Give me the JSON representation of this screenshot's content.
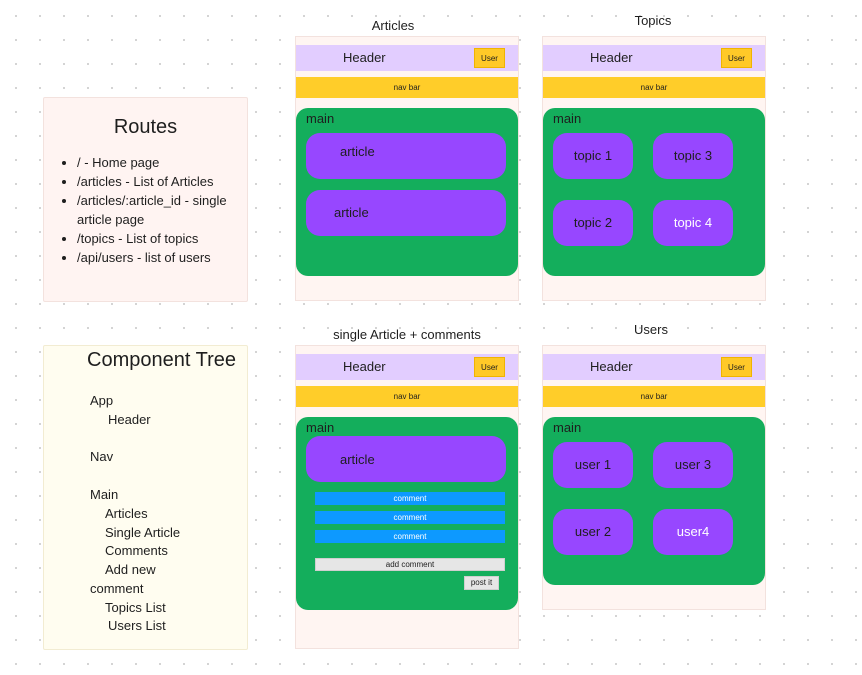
{
  "routes": {
    "title": "Routes",
    "items": [
      "/ - Home page",
      "/articles - List of Articles",
      "/articles/:article_id - single article page",
      "/topics - List of topics",
      "/api/users - list of users"
    ]
  },
  "component_tree": {
    "title": "Component Tree",
    "items": [
      "App",
      "Header",
      "Nav",
      "Main",
      "Articles",
      "Single Article",
      "Comments",
      "Add new",
      "comment",
      "Topics List",
      "Users List"
    ]
  },
  "common": {
    "header": "Header",
    "user_button": "User",
    "nav_bar": "nav bar",
    "main": "main"
  },
  "frames": {
    "articles": {
      "title": "Articles",
      "cards": [
        "article",
        "article"
      ]
    },
    "topics": {
      "title": "Topics",
      "tiles": [
        "topic 1",
        "topic 3",
        "topic 2",
        "topic 4"
      ]
    },
    "single_article": {
      "title": "single Article + comments",
      "article": "article",
      "comments": [
        "comment",
        "comment",
        "comment"
      ],
      "add_comment": "add comment",
      "post_button": "post it"
    },
    "users": {
      "title": "Users",
      "tiles": [
        "user 1",
        "user 3",
        "user 2",
        "user4"
      ]
    }
  },
  "colors": {
    "header": "#e2cdff",
    "nav_bar": "#ffcd29",
    "main": "#14ae5c",
    "card": "#9747ff",
    "comment": "#0d99ff",
    "user_button": "#ffc928"
  }
}
